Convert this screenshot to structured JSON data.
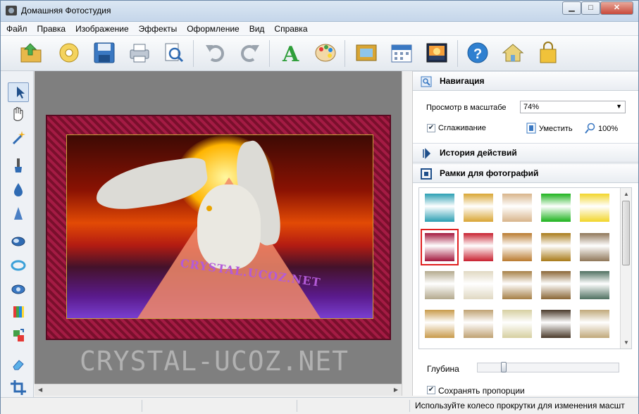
{
  "window": {
    "title": "Домашняя Фотостудия"
  },
  "menu": [
    "Файл",
    "Правка",
    "Изображение",
    "Эффекты",
    "Оформление",
    "Вид",
    "Справка"
  ],
  "canvas": {
    "watermark": "CRYSTAL-UCOZ.NET",
    "inner_watermark": "CRYSTAL.UCOZ.NET"
  },
  "navigation": {
    "title": "Навигация",
    "zoom_label": "Просмотр в масштабе",
    "zoom_value": "74%",
    "smoothing_label": "Сглаживание",
    "smoothing_checked": true,
    "fit_label": "Уместить",
    "actual_label": "100%"
  },
  "history": {
    "title": "История действий"
  },
  "frames": {
    "title": "Рамки для фотографий",
    "depth_label": "Глубина",
    "depth_level": 0.17,
    "keep_proportions_label": "Сохранять пропорции",
    "keep_proportions_checked": true,
    "selected_index": 5,
    "thumb_colors": [
      "#2b9fb3",
      "#d9a533",
      "#d8b48a",
      "#1db31d",
      "#f2d52a",
      "#a3173d",
      "#c8202f",
      "#b97a2e",
      "#a87a18",
      "#8f7658",
      "#b3a98d",
      "#e0d8c2",
      "#a67f45",
      "#8a6535",
      "#4f7060",
      "#c89a4a",
      "#bfa172",
      "#d6cfa0",
      "#4a3a2a",
      "#c0a87a"
    ]
  },
  "status": {
    "message": "Используйте колесо прокрутки для изменения масшт"
  }
}
